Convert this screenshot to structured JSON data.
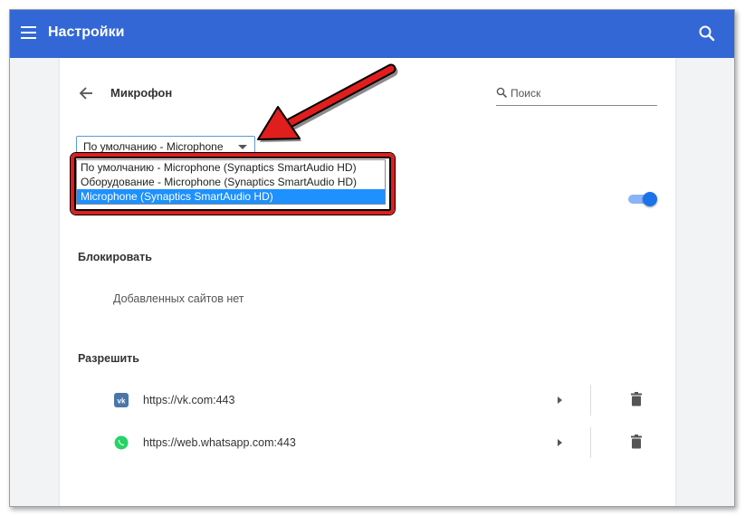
{
  "header": {
    "title": "Настройки",
    "menu_icon": "hamburger-icon",
    "search_icon": "search-icon",
    "bar_color": "#3367d6"
  },
  "page": {
    "title": "Микрофон",
    "back_icon": "arrow-left-icon"
  },
  "search": {
    "placeholder": "Поиск",
    "value": ""
  },
  "microphone_select": {
    "value": "По умолчанию - Microphone",
    "options": [
      "По умолчанию - Microphone (Synaptics SmartAudio HD)",
      "Оборудование - Microphone (Synaptics SmartAudio HD)",
      "Microphone (Synaptics SmartAudio HD)"
    ],
    "highlighted_index": 2,
    "highlight_color": "#1e90ff"
  },
  "ask_toggle": {
    "on": true,
    "color": "#1a73e8"
  },
  "block_section": {
    "heading": "Блокировать",
    "empty_text": "Добавленных сайтов нет"
  },
  "allow_section": {
    "heading": "Разрешить",
    "sites": [
      {
        "url": "https://vk.com:443",
        "icon": "vk-icon",
        "icon_color": "#4a76a8"
      },
      {
        "url": "https://web.whatsapp.com:443",
        "icon": "whatsapp-icon",
        "icon_color": "#25d366"
      }
    ]
  },
  "annotation": {
    "color": "#e01e1e"
  }
}
